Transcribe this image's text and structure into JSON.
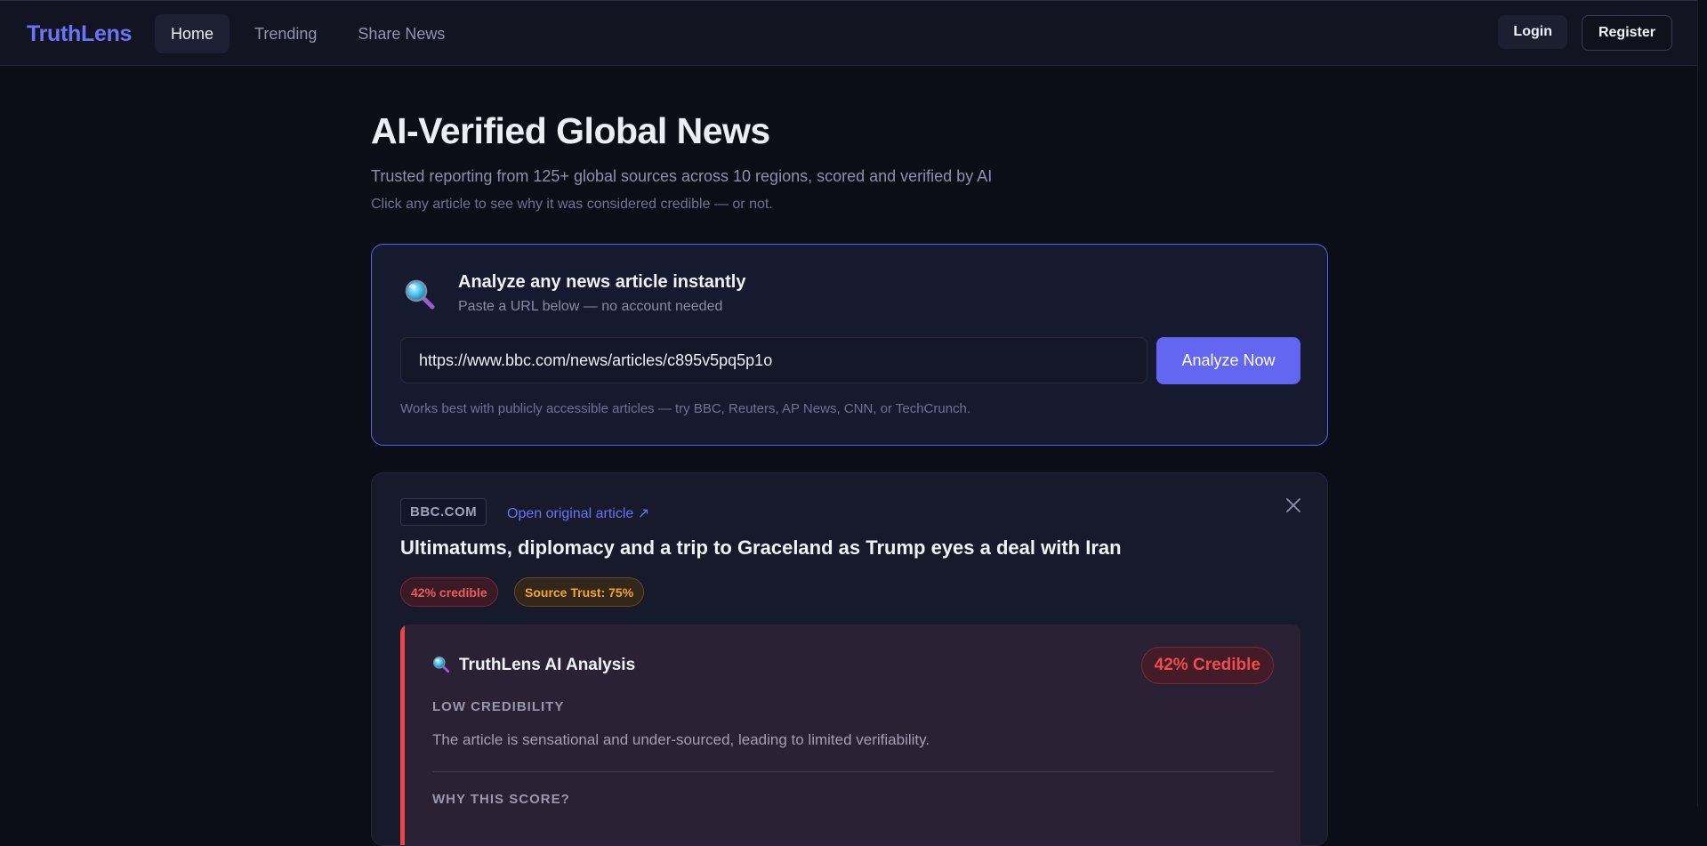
{
  "nav": {
    "brand": "TruthLens",
    "links": [
      {
        "label": "Home",
        "active": true
      },
      {
        "label": "Trending",
        "active": false
      },
      {
        "label": "Share News",
        "active": false
      }
    ],
    "login_label": "Login",
    "register_label": "Register"
  },
  "hero": {
    "title": "AI-Verified Global News",
    "subtitle": "Trusted reporting from 125+ global sources across 10 regions, scored and verified by AI",
    "hint": "Click any article to see why it was considered credible — or not."
  },
  "analyze": {
    "icon": "magnifier-icon",
    "title": "Analyze any news article instantly",
    "subtitle": "Paste a URL below — no account needed",
    "url_value": "https://www.bbc.com/news/articles/c895v5pq5p1o",
    "button_label": "Analyze Now",
    "note": "Works best with publicly accessible articles — try BBC, Reuters, AP News, CNN, or TechCrunch."
  },
  "article": {
    "source": "BBC.COM",
    "open_link": "Open original article ↗",
    "title": "Ultimatums, diplomacy and a trip to Graceland as Trump eyes a deal with Iran",
    "credibility_pill": "42% credible",
    "trust_pill": "Source Trust: 75%",
    "analysis": {
      "title": "TruthLens AI Analysis",
      "score": "42% Credible",
      "level": "LOW CREDIBILITY",
      "summary": "The article is sensational and under-sourced, leading to limited verifiability.",
      "why_heading": "WHY THIS SCORE?"
    }
  },
  "colors": {
    "accent": "#6366f1",
    "brand": "#6b73f6",
    "danger": "#ef4444",
    "warning": "#f5a623",
    "background": "#0b0d17"
  }
}
